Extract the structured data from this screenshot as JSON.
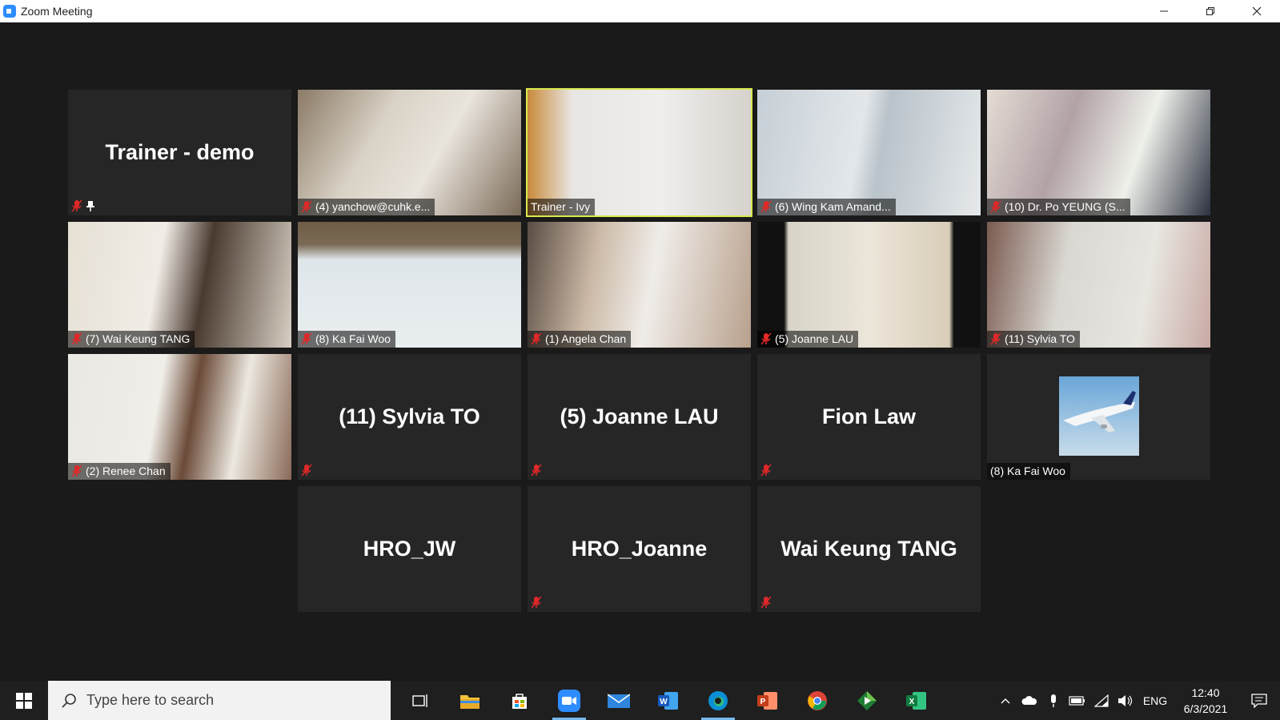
{
  "window": {
    "title": "Zoom Meeting",
    "accent": "#2d8cff"
  },
  "tiles": [
    {
      "name": "Trainer - demo",
      "label": "",
      "muted": true,
      "pinned": true,
      "video": false
    },
    {
      "name": "",
      "label": "(4)  yanchow@cuhk.e...",
      "muted": true,
      "video": true
    },
    {
      "name": "",
      "label": "Trainer - Ivy",
      "muted": false,
      "video": true,
      "active": true
    },
    {
      "name": "",
      "label": "(6)  Wing Kam Amand...",
      "muted": true,
      "video": true
    },
    {
      "name": "",
      "label": "(10)  Dr. Po YEUNG (S...",
      "muted": true,
      "video": true
    },
    {
      "name": "",
      "label": "(7)  Wai Keung TANG",
      "muted": true,
      "video": true
    },
    {
      "name": "",
      "label": "(8)  Ka Fai Woo",
      "muted": true,
      "video": true
    },
    {
      "name": "",
      "label": "(1)  Angela Chan",
      "muted": true,
      "video": true
    },
    {
      "name": "",
      "label": "(5)  Joanne LAU",
      "muted": true,
      "video": true
    },
    {
      "name": "",
      "label": "(11)  Sylvia TO",
      "muted": true,
      "video": true
    },
    {
      "name": "",
      "label": "(2)  Renee Chan",
      "muted": true,
      "video": true
    },
    {
      "name": "(11)  Sylvia TO",
      "label": "",
      "muted": true,
      "video": false
    },
    {
      "name": "(5)  Joanne LAU",
      "label": "",
      "muted": true,
      "video": false
    },
    {
      "name": "Fion Law",
      "label": "",
      "muted": true,
      "video": false
    },
    {
      "name": "",
      "label": "(8)  Ka Fai Woo",
      "muted": false,
      "video": false,
      "avatar": "airplane-avatar"
    },
    {
      "name": "HRO_JW",
      "label": "",
      "muted": false,
      "video": false
    },
    {
      "name": "HRO_Joanne",
      "label": "",
      "muted": true,
      "video": false
    },
    {
      "name": "Wai Keung TANG",
      "label": "",
      "muted": true,
      "video": false
    }
  ],
  "taskbar": {
    "search_placeholder": "Type here to search",
    "apps": [
      "task-view-icon",
      "file-explorer-icon",
      "store-icon",
      "zoom-icon",
      "mail-icon",
      "word-icon",
      "edge-icon",
      "powerpoint-icon",
      "chrome-icon",
      "media-player-icon",
      "excel-icon"
    ],
    "language": "ENG",
    "time": "12:40",
    "date": "6/3/2021"
  },
  "colors": {
    "active_speaker": "#d8e94e",
    "muted_red": "#e02828"
  }
}
